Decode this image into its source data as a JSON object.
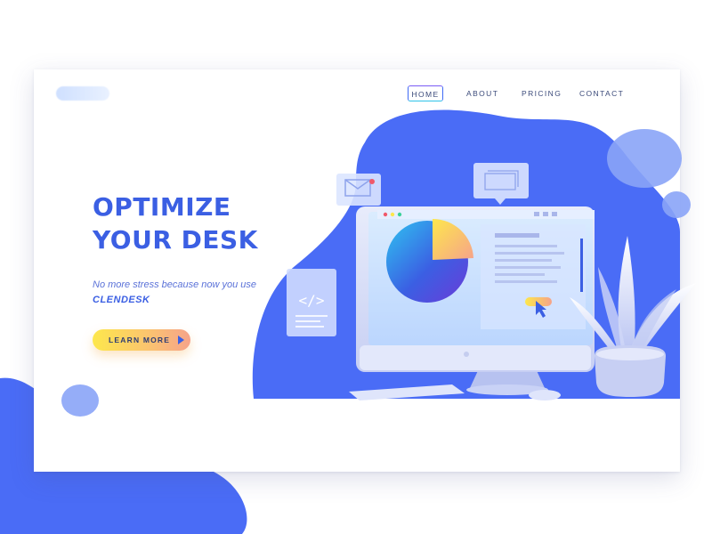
{
  "nav": {
    "items": [
      {
        "label": "HOME",
        "active": true
      },
      {
        "label": "ABOUT",
        "active": false
      },
      {
        "label": "PRICING",
        "active": false
      },
      {
        "label": "CONTACT",
        "active": false
      }
    ]
  },
  "hero": {
    "headline_line1": "OPTIMIZE",
    "headline_line2": "YOUR DESK",
    "subtext_prefix": "No more stress because now you use",
    "brand": "CLENDESK",
    "cta_label": "LEARN MORE"
  },
  "illustration": {
    "code_card_symbol": "</>",
    "icons": [
      "mail-icon",
      "chat-bubble-icon",
      "code-card-icon",
      "pie-chart-icon",
      "cursor-icon",
      "plant-icon"
    ]
  },
  "colors": {
    "brand_blue": "#3b5fe3",
    "blob_blue": "#4a6cf6",
    "light_blob": "#8aa4f7",
    "cta_gradient_start": "#fde74c",
    "cta_gradient_end": "#f6a38a",
    "text_dark": "#3b4a7a"
  }
}
